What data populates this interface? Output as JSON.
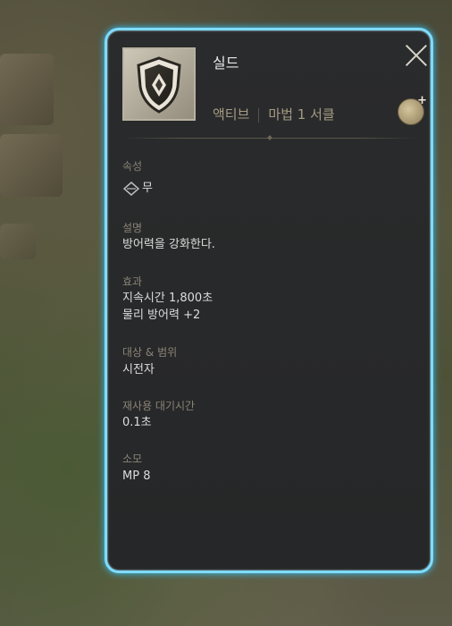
{
  "skill": {
    "name": "실드",
    "type": "액티브",
    "category": "마법 1 서클",
    "icon": "shield-icon"
  },
  "sections": {
    "attribute": {
      "label": "속성",
      "value": "무",
      "icon": "diamond-attribute-icon"
    },
    "description": {
      "label": "설명",
      "value": "방어력을 강화한다."
    },
    "effect": {
      "label": "효과",
      "lines": [
        "지속시간 1,800초",
        "물리 방어력 +2"
      ]
    },
    "target": {
      "label": "대상 & 범위",
      "value": "시전자"
    },
    "cooldown": {
      "label": "재사용 대기시간",
      "value": "0.1초"
    },
    "cost": {
      "label": "소모",
      "value": "MP 8"
    }
  },
  "colors": {
    "frame_glow": "#7fdcff",
    "panel_bg": "#262728",
    "label": "#8a8477",
    "value": "#dcdcdc",
    "type_text": "#a59b82"
  }
}
